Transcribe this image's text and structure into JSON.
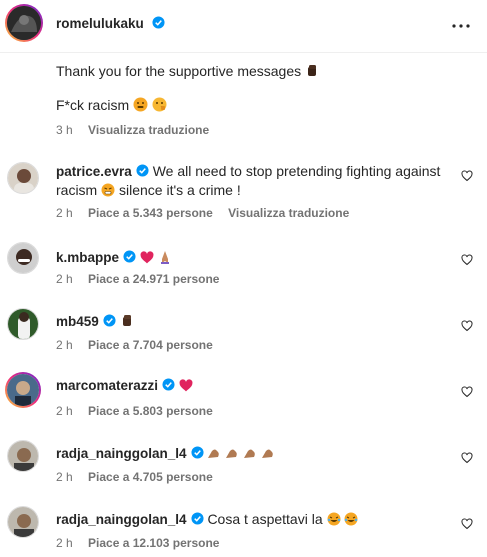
{
  "post": {
    "author": "romelulukaku",
    "caption_line1": "Thank you for the supportive messages",
    "caption_line2": "F*ck racism",
    "time": "3 h",
    "translate": "Visualizza traduzione"
  },
  "comments": [
    {
      "username": "patrice.evra",
      "text_line1": "We all need to stop pretending fighting against",
      "text_line2_a": "racism",
      "text_line2_b": "silence it's a crime !",
      "time": "2 h",
      "likes": "Piace a 5.343 persone",
      "translate": "Visualizza traduzione"
    },
    {
      "username": "k.mbappe",
      "text": "",
      "time": "2 h",
      "likes": "Piace a 24.971 persone"
    },
    {
      "username": "mb459",
      "text": "",
      "time": "2 h",
      "likes": "Piace a 7.704 persone"
    },
    {
      "username": "marcomaterazzi",
      "text": "",
      "time": "2 h",
      "likes": "Piace a 5.803 persone"
    },
    {
      "username": "radja_nainggolan_l4",
      "text": "",
      "time": "2 h",
      "likes": "Piace a 4.705 persone"
    },
    {
      "username": "radja_nainggolan_l4",
      "text": "Cosa t aspettavi la",
      "time": "2 h",
      "likes": "Piace a 12.103 persone"
    }
  ],
  "colors": {
    "verified": "#0095f6",
    "muted": "#737373",
    "heart_red": "#ed4956"
  },
  "icons": {
    "more": "more-options-icon",
    "verified": "verified-badge-icon",
    "like": "heart-outline-icon"
  }
}
